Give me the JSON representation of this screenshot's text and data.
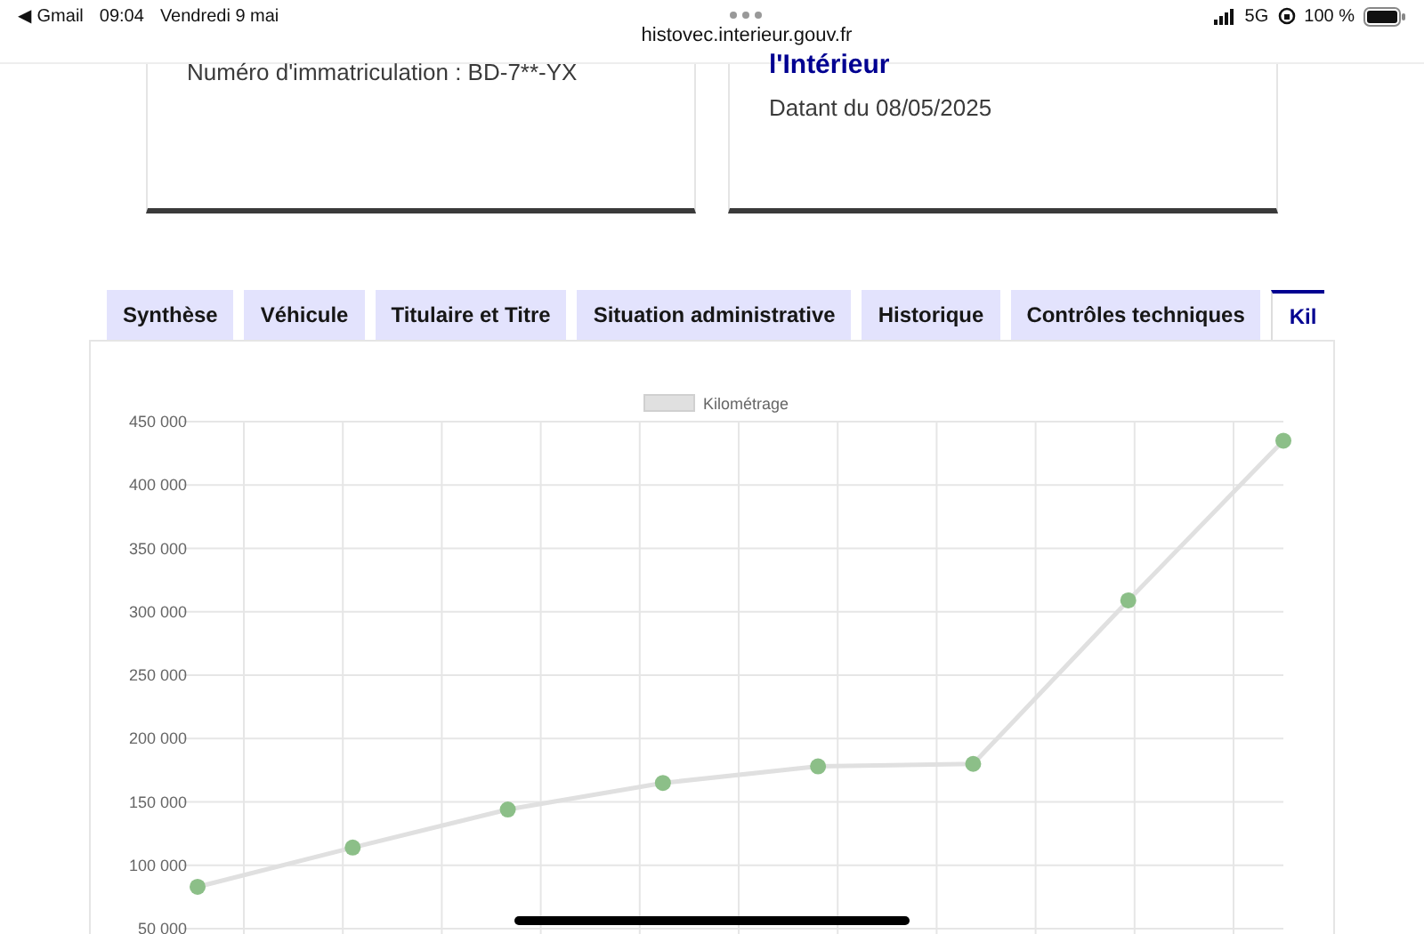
{
  "status_bar": {
    "back_app": "◀ Gmail",
    "time": "09:04",
    "date": "Vendredi 9 mai",
    "url": "histovec.interieur.gouv.fr",
    "network": "5G",
    "battery": "100 %"
  },
  "cards": [
    {
      "lines": [
        {
          "kind": "text",
          "text": "Numéro d'immatriculation : BD-7**-YX"
        }
      ]
    },
    {
      "lines": [
        {
          "kind": "title",
          "text": "l'Intérieur"
        },
        {
          "kind": "text",
          "text": "Datant du 08/05/2025"
        }
      ]
    }
  ],
  "tabs": [
    {
      "label": "Synthèse",
      "selected": false
    },
    {
      "label": "Véhicule",
      "selected": false
    },
    {
      "label": "Titulaire et Titre",
      "selected": false
    },
    {
      "label": "Situation administrative",
      "selected": false
    },
    {
      "label": "Historique",
      "selected": false
    },
    {
      "label": "Contrôles techniques",
      "selected": false
    },
    {
      "label": "Kil",
      "selected": true
    }
  ],
  "chart_data": {
    "type": "line",
    "ylim": [
      50000,
      450000
    ],
    "yticks": [
      {
        "value": 50000,
        "label": "50 000"
      },
      {
        "value": 100000,
        "label": "100 000"
      },
      {
        "value": 150000,
        "label": "150 000"
      },
      {
        "value": 200000,
        "label": "200 000"
      },
      {
        "value": 250000,
        "label": "250 000"
      },
      {
        "value": 300000,
        "label": "300 000"
      },
      {
        "value": 350000,
        "label": "350 000"
      },
      {
        "value": 400000,
        "label": "400 000"
      },
      {
        "value": 450000,
        "label": "450 000"
      }
    ],
    "grid": true,
    "series": [
      {
        "name": "Kilométrage",
        "color": "#e0e0e0",
        "marker": "o",
        "values": [
          83000,
          114000,
          144000,
          165000,
          178000,
          180000,
          309000,
          435000
        ]
      }
    ]
  }
}
